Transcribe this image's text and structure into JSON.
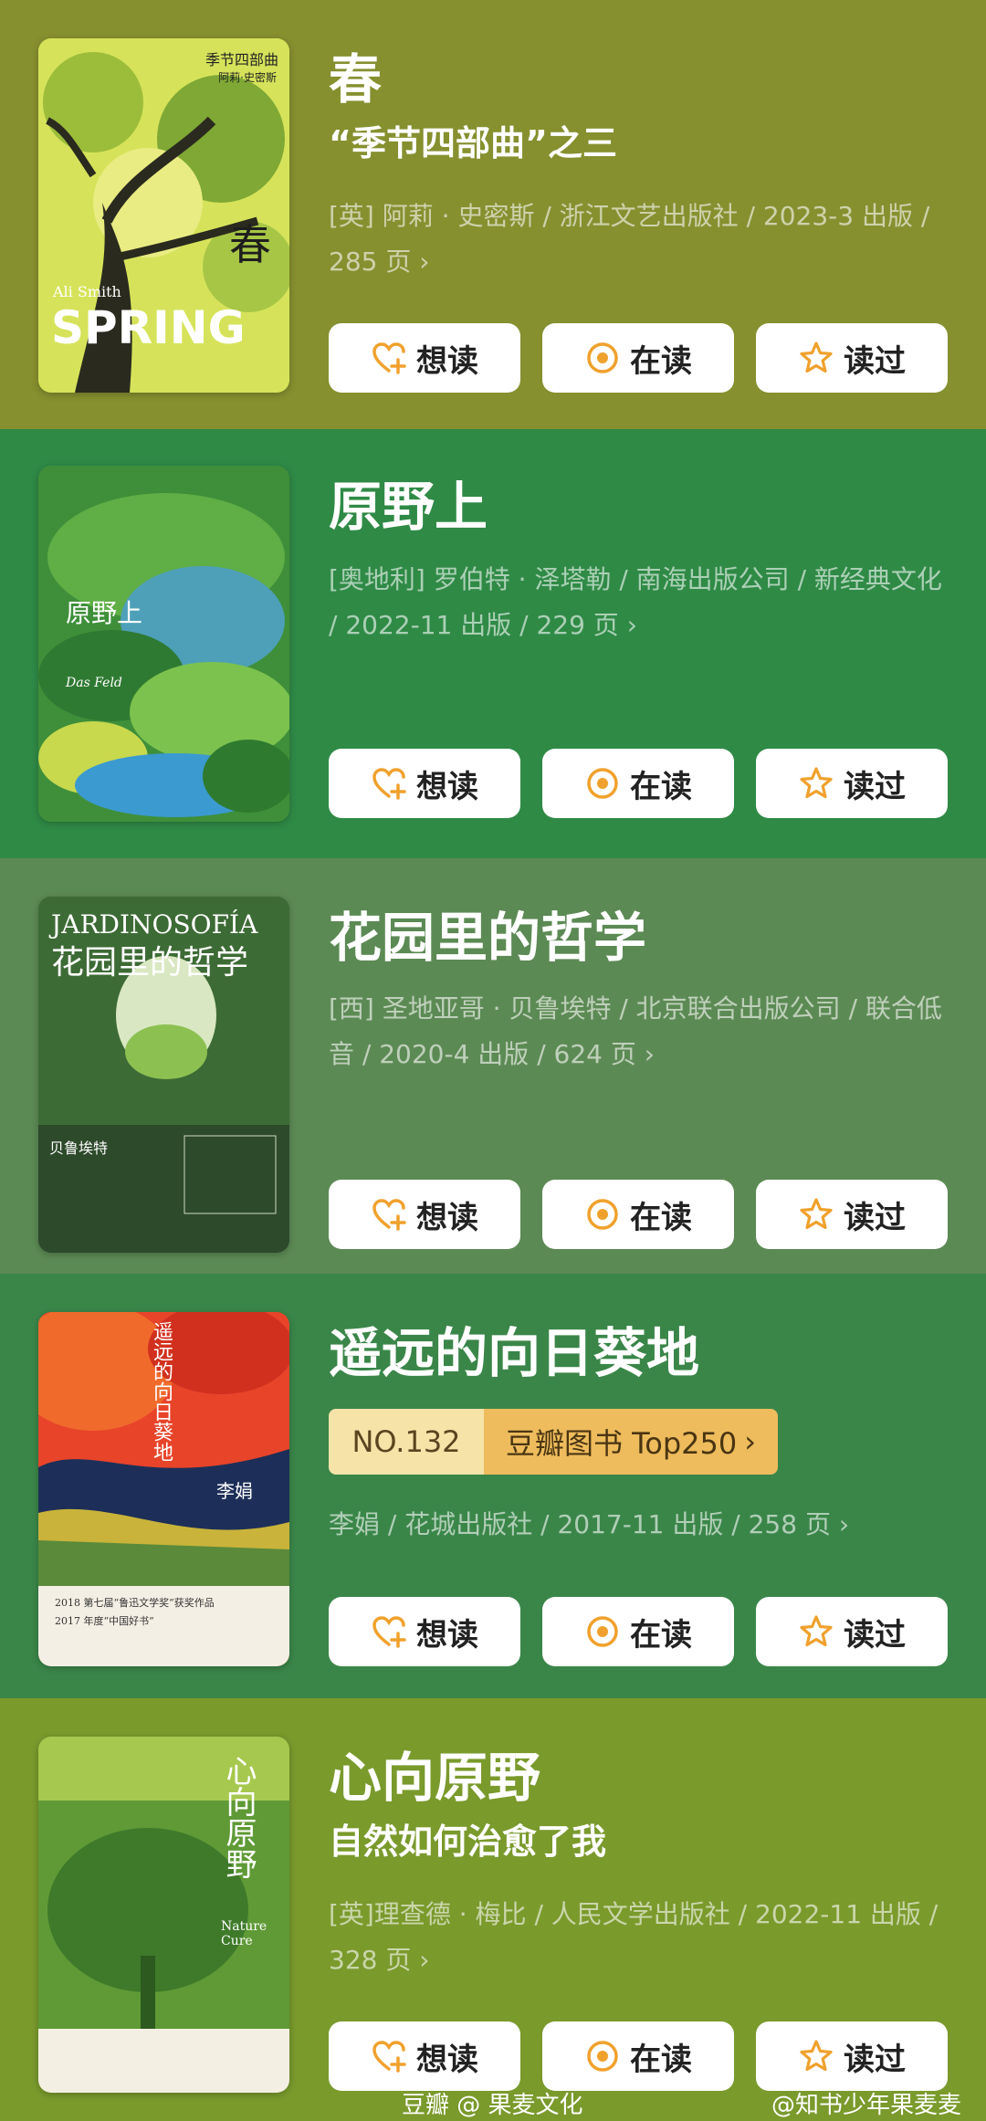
{
  "books": [
    {
      "title": "春",
      "subtitle": "“季节四部曲”之三",
      "meta": "[英] 阿莉 · 史密斯 / 浙江文艺出版社 / 2023-3 出版 / 285 页",
      "buttons": {
        "want": "想读",
        "reading": "在读",
        "read": "读过"
      },
      "cover": {
        "series": "季节四部曲",
        "author": "阿莉·史密斯",
        "title_zh": "春",
        "author_en": "Ali Smith",
        "title_en": "SPRING"
      },
      "bg": "#86902f"
    },
    {
      "title": "原野上",
      "meta": "[奥地利] 罗伯特 · 泽塔勒 / 南海出版公司 / 新经典文化 / 2022-11 出版 / 229 页",
      "buttons": {
        "want": "想读",
        "reading": "在读",
        "read": "读过"
      },
      "cover": {
        "title_zh": "原野上",
        "title_de": "Das Feld"
      },
      "bg": "#2f8a46"
    },
    {
      "title": "花园里的哲学",
      "meta": "[西] 圣地亚哥 · 贝鲁埃特 / 北京联合出版公司 / 联合低音 / 2020-4 出版 / 624 页",
      "buttons": {
        "want": "想读",
        "reading": "在读",
        "read": "读过"
      },
      "cover": {
        "title_es": "JARDINOSOFÍA",
        "title_zh": "花园里的哲学",
        "author": "贝鲁埃特"
      },
      "bg": "#5c8a54"
    },
    {
      "title": "遥远的向日葵地",
      "rank": {
        "no": "NO.132",
        "label": "豆瓣图书 Top250"
      },
      "meta": "李娟 / 花城出版社 / 2017-11 出版 / 258 页",
      "buttons": {
        "want": "想读",
        "reading": "在读",
        "read": "读过"
      },
      "cover": {
        "title_zh": "遥远的向日葵地",
        "author": "李娟",
        "award1": "2018 第七届“鲁迅文学奖”获奖作品",
        "award2": "2017 年度“中国好书”"
      },
      "bg": "#3a8649"
    },
    {
      "title": "心向原野",
      "subtitle": "自然如何治愈了我",
      "meta": "[英]理查德 · 梅比 / 人民文学出版社 / 2022-11 出版 / 328 页",
      "buttons": {
        "want": "想读",
        "reading": "在读",
        "read": "读过"
      },
      "cover": {
        "title_zh": "心向原野",
        "title_en": "Nature Cure"
      },
      "bg": "#7a9a2c"
    }
  ],
  "footer": {
    "left": "豆瓣 @ 果麦文化",
    "right": "@知书少年果麦麦"
  },
  "colors": {
    "accent": "#f0a12d"
  }
}
